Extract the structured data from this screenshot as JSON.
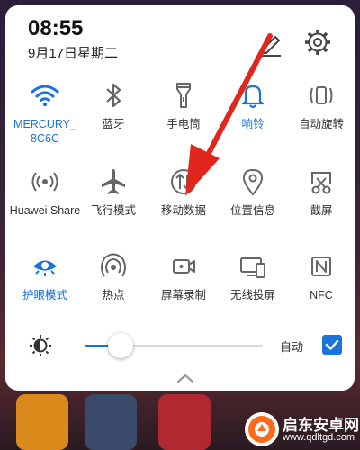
{
  "status": {
    "time": "08:55",
    "date": "9月17日星期二"
  },
  "tiles": [
    {
      "label": "MERCURY_8C6C",
      "active": true,
      "icon": "wifi-icon"
    },
    {
      "label": "蓝牙",
      "active": false,
      "icon": "bluetooth-icon"
    },
    {
      "label": "手电筒",
      "active": false,
      "icon": "flashlight-icon"
    },
    {
      "label": "响铃",
      "active": true,
      "icon": "bell-icon"
    },
    {
      "label": "自动旋转",
      "active": false,
      "icon": "auto-rotate-icon"
    },
    {
      "label": "Huawei Share",
      "active": false,
      "icon": "huawei-share-icon"
    },
    {
      "label": "飞行模式",
      "active": false,
      "icon": "airplane-icon"
    },
    {
      "label": "移动数据",
      "active": false,
      "icon": "mobile-data-icon"
    },
    {
      "label": "位置信息",
      "active": false,
      "icon": "location-icon"
    },
    {
      "label": "截屏",
      "active": false,
      "icon": "screenshot-icon"
    },
    {
      "label": "护眼模式",
      "active": true,
      "icon": "eye-comfort-icon"
    },
    {
      "label": "热点",
      "active": false,
      "icon": "hotspot-icon"
    },
    {
      "label": "屏幕录制",
      "active": false,
      "icon": "screen-record-icon"
    },
    {
      "label": "无线投屏",
      "active": false,
      "icon": "wireless-projection-icon"
    },
    {
      "label": "NFC",
      "active": false,
      "icon": "nfc-icon"
    }
  ],
  "brightness": {
    "level": 0.2,
    "auto_label": "自动",
    "auto_checked": true
  },
  "colors": {
    "accent": "#1a73d9",
    "arrow": "#e0261d"
  },
  "watermark": {
    "title": "启东安卓网",
    "url": "www.qdltgd.com"
  }
}
